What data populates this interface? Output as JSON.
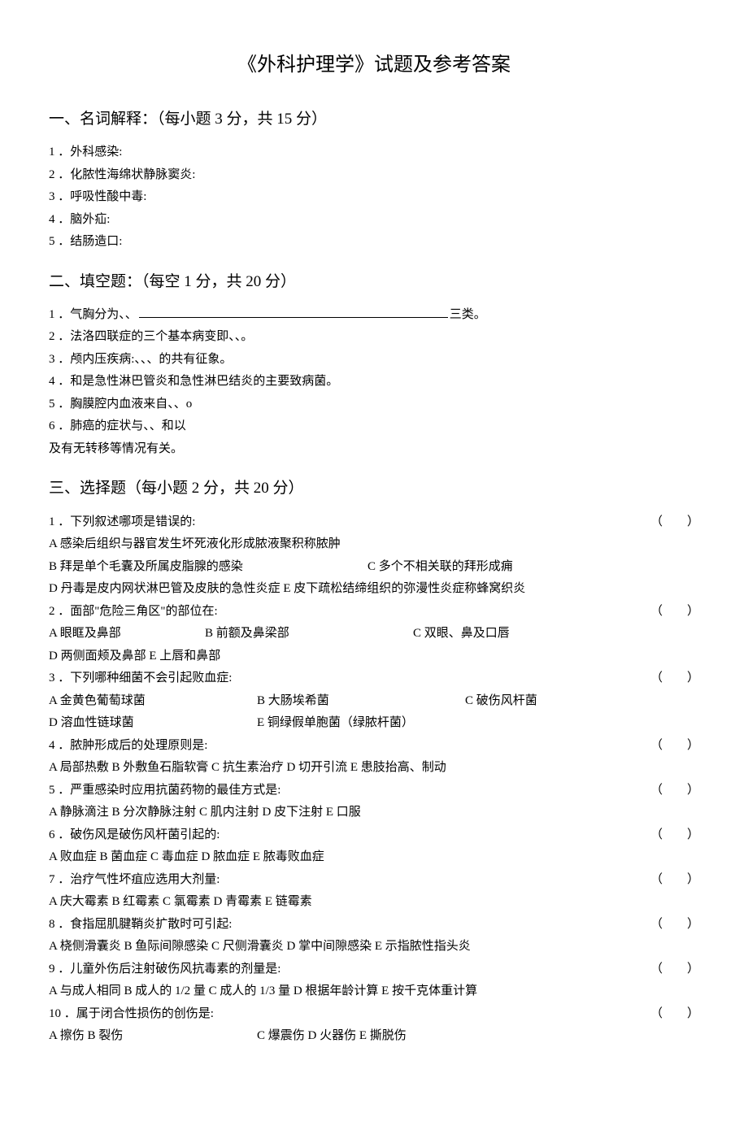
{
  "title": "《外科护理学》试题及参考答案",
  "s1": {
    "head": "一、名词解释：（每小题 3 分，共 15 分）",
    "items": [
      "1 ．外科感染:",
      "2 ．化脓性海绵状静脉窦炎:",
      "3 ．呼吸性酸中毒:",
      "4 ．脑外疝:",
      "5 ．结肠造口:"
    ]
  },
  "s2": {
    "head": "二、填空题：（每空 1 分，共 20 分）",
    "q1_a": "1 ．气胸分为、、",
    "q1_b": "三类。",
    "items": [
      "2 ．法洛四联症的三个基本病变即、、。",
      "3 ．颅内压疾病:、、、的共有征象。",
      "4 ．和是急性淋巴管炎和急性淋巴结炎的主要致病菌。",
      "5 ．胸膜腔内血液来自、、o",
      "6 ．肺癌的症状与、、和以",
      "及有无转移等情况有关。"
    ]
  },
  "s3": {
    "head": "三、选择题（每小题 2 分，共 20 分）",
    "paren": "（        ）",
    "q1": {
      "stem": "1 ．下列叙述哪项是错误的:",
      "a": "A 感染后组织与器官发生坏死液化形成脓液聚积称脓肿",
      "b": "B 拜是单个毛囊及所属皮脂腺的感染",
      "c": "C 多个不相关联的拜形成痈",
      "d": "D 丹毒是皮内网状淋巴管及皮肤的急性炎症 E 皮下疏松结缔组织的弥漫性炎症称蜂窝织炎"
    },
    "q2": {
      "stem": "2 ．面部\"危险三角区\"的部位在:",
      "a": "A 眼眶及鼻部",
      "b": "B 前额及鼻梁部",
      "c": "C 双眼、鼻及口唇",
      "d": "D 两侧面颊及鼻部 E 上唇和鼻部"
    },
    "q3": {
      "stem": "3 ．下列哪种细菌不会引起败血症:",
      "a": "A 金黄色葡萄球菌",
      "b": "B 大肠埃希菌",
      "c": "C 破伤风杆菌",
      "d": "D 溶血性链球菌",
      "e": "E 铜绿假单胞菌（绿脓杆菌）"
    },
    "q4": {
      "stem": "4 ．脓肿形成后的处理原则是:",
      "opts": "A 局部热敷 B 外敷鱼石脂软膏 C 抗生素治疗 D 切开引流 E 患肢抬高、制动"
    },
    "q5": {
      "stem": "5 ．严重感染时应用抗菌药物的最佳方式是:",
      "opts": "A 静脉滴注 B 分次静脉注射 C 肌内注射 D 皮下注射 E 口服"
    },
    "q6": {
      "stem": "6 ．破伤风是破伤风杆菌引起的:",
      "opts": "A 败血症 B 菌血症 C 毒血症 D 脓血症 E 脓毒败血症"
    },
    "q7": {
      "stem": "7 ．治疗气性坏疽应选用大剂量:",
      "opts": "A 庆大霉素 B 红霉素 C 氯霉素 D 青霉素 E 链霉素"
    },
    "q8": {
      "stem": "8 ．食指屈肌腱鞘炎扩散时可引起:",
      "opts": "A 桡侧滑囊炎 B 鱼际间隙感染 C 尺侧滑囊炎 D 掌中间隙感染 E 示指脓性指头炎"
    },
    "q9": {
      "stem": "9 ．儿童外伤后注射破伤风抗毒素的剂量是:",
      "opts": "A 与成人相同 B 成人的 1/2 量 C 成人的 1/3 量 D 根据年龄计算 E 按千克体重计算"
    },
    "q10": {
      "stem": "10 ．属于闭合性损伤的创伤是:",
      "a": "A 擦伤 B 裂伤",
      "c": "C 爆震伤 D 火器伤 E 撕脱伤"
    }
  }
}
